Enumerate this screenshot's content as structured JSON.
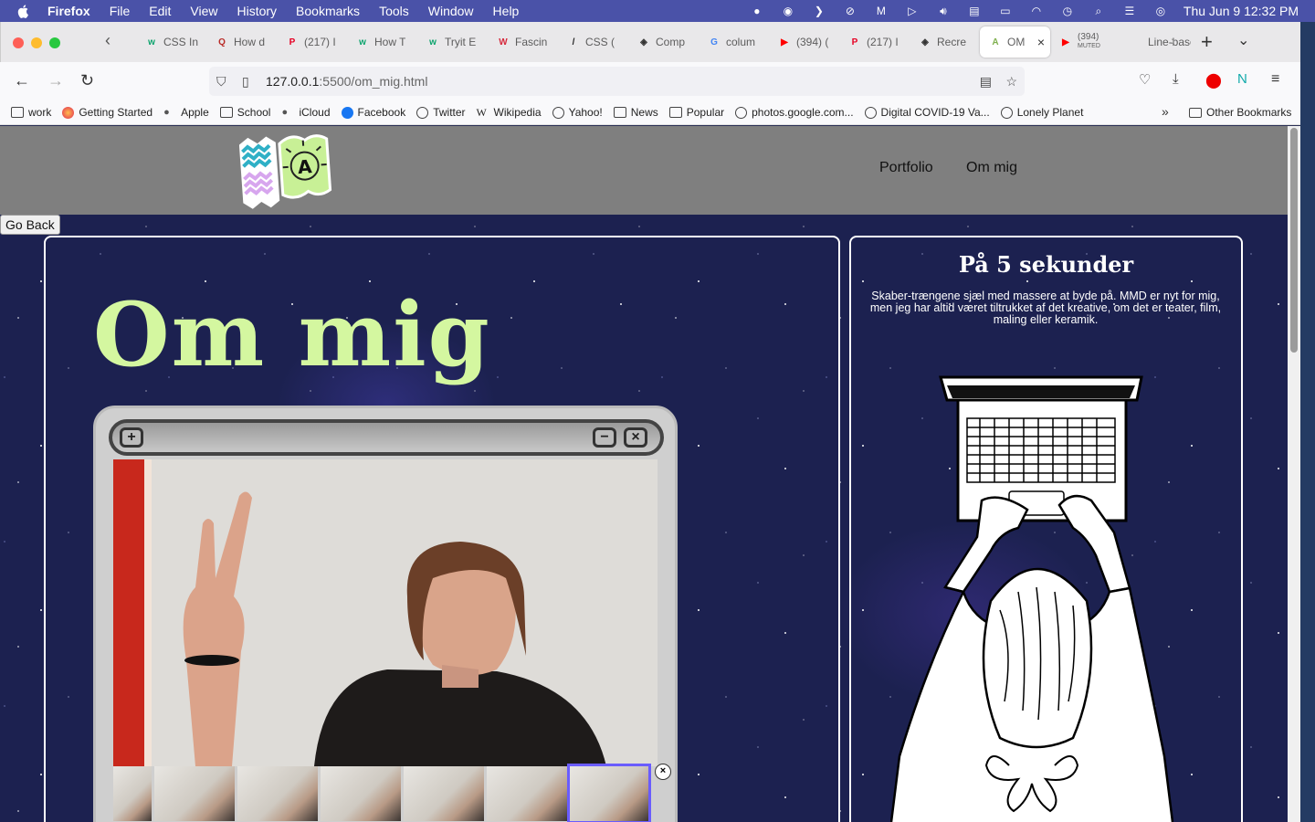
{
  "menubar": {
    "app": "Firefox",
    "items": [
      "File",
      "Edit",
      "View",
      "History",
      "Bookmarks",
      "Tools",
      "Window",
      "Help"
    ],
    "datetime": "Thu Jun 9  12:32 PM",
    "status_icons": [
      "control-icon",
      "record-icon",
      "arrow-icon",
      "sync-icon",
      "m-icon",
      "play-icon",
      "volume-icon",
      "flag-icon",
      "battery-icon",
      "wifi-icon",
      "clock-icon",
      "search-icon",
      "control-center-icon",
      "siri-icon"
    ]
  },
  "tabs": [
    {
      "label": "CSS In",
      "icon": "w",
      "color": "#0aa36c"
    },
    {
      "label": "How d",
      "icon": "Q",
      "color": "#b92b27"
    },
    {
      "label": "(217) I",
      "icon": "P",
      "color": "#e60023"
    },
    {
      "label": "How T",
      "icon": "w",
      "color": "#0aa36c"
    },
    {
      "label": "Tryit E",
      "icon": "w",
      "color": "#0aa36c"
    },
    {
      "label": "Fascin",
      "icon": "W",
      "color": "#d6293c"
    },
    {
      "label": "CSS (",
      "icon": "/",
      "color": "#222"
    },
    {
      "label": "Comp",
      "icon": "◈",
      "color": "#333"
    },
    {
      "label": "colum",
      "icon": "G",
      "color": "#4285f4"
    },
    {
      "label": "(394) (",
      "icon": "▶",
      "color": "#ff0000"
    },
    {
      "label": "(217) I",
      "icon": "P",
      "color": "#e60023"
    },
    {
      "label": "Recre",
      "icon": "◈",
      "color": "#333"
    },
    {
      "label": "OM",
      "icon": "A",
      "color": "#7fb04e",
      "active": true
    },
    {
      "label": "(394)",
      "sublabel": "MUTED",
      "icon": "▶",
      "color": "#ff0000"
    },
    {
      "label": "Line-base",
      "icon": "",
      "color": "transparent"
    }
  ],
  "url": {
    "host": "127.0.0.1",
    "path": ":5500/om_mig.html"
  },
  "bookmarks": [
    {
      "label": "work",
      "type": "folder"
    },
    {
      "label": "Getting Started",
      "type": "firefox"
    },
    {
      "label": "Apple",
      "type": "apple"
    },
    {
      "label": "School",
      "type": "folder"
    },
    {
      "label": "iCloud",
      "type": "apple"
    },
    {
      "label": "Facebook",
      "type": "facebook"
    },
    {
      "label": "Twitter",
      "type": "globe"
    },
    {
      "label": "Wikipedia",
      "type": "wiki"
    },
    {
      "label": "Yahoo!",
      "type": "globe"
    },
    {
      "label": "News",
      "type": "folder"
    },
    {
      "label": "Popular",
      "type": "folder"
    },
    {
      "label": "photos.google.com...",
      "type": "globe"
    },
    {
      "label": "Digital COVID-19 Va...",
      "type": "globe"
    },
    {
      "label": "Lonely Planet",
      "type": "globe"
    }
  ],
  "other_bookmarks": "Other Bookmarks",
  "site": {
    "nav": [
      "Portfolio",
      "Om mig"
    ],
    "go_back": "Go Back",
    "title": "Om mig",
    "right_title": "På 5 sekunder",
    "right_text": "Skaber-trængene sjæl med massere at byde på. MMD er nyt for mig, men jeg har altid været tiltrukket af det kreative, om det er teater, film, maling eller keramik.",
    "thumb_close": "×",
    "accent": "#d4f7a0"
  }
}
